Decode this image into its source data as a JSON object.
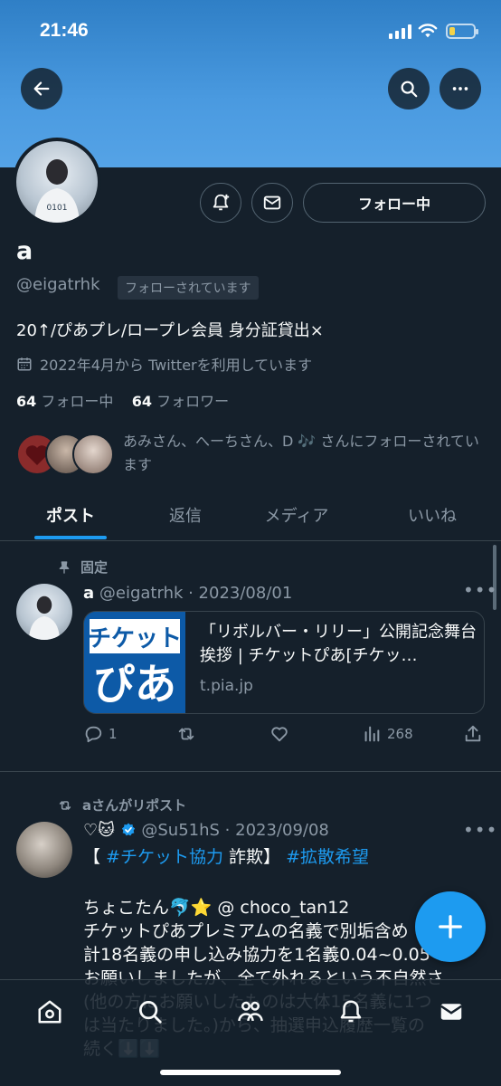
{
  "status_bar": {
    "time": "21:46"
  },
  "profile": {
    "name": "a",
    "handle": "@eigatrhk",
    "follows_you_badge": "フォローされています",
    "follow_button_label": "フォロー中",
    "bio": "20↑/ぴあプレ/ロープレ会員 身分証貸出×",
    "joined": "2022年4月から Twitterを利用しています",
    "following_count": "64",
    "following_label": "フォロー中",
    "followers_count": "64",
    "followers_label": "フォロワー",
    "followers_you_know": "あみさん、へーちさん、D 🎶 さんにフォローされています"
  },
  "tabs": [
    {
      "label": "ポスト"
    },
    {
      "label": "返信"
    },
    {
      "label": "メディア"
    },
    {
      "label": "いいね"
    }
  ],
  "posts": [
    {
      "context": "固定",
      "name": "a",
      "handle_date": "@eigatrhk · 2023/08/01",
      "card": {
        "image_text_top": "チケット",
        "image_text_bottom": "ぴあ",
        "title": "「リボルバー・リリー」公開記念舞台挨拶 | チケットぴあ[チケッ…",
        "domain": "t.pia.jp"
      },
      "replies": "1",
      "retweets": "",
      "likes": "",
      "views": "268"
    },
    {
      "context": "aさんがリポスト",
      "name": "♡🐱",
      "handle_date": "@Su51hS · 2023/09/08",
      "line1_a": "【 ",
      "line1_link1": "#チケット協力",
      "line1_b": " 詐欺】 ",
      "line1_link2": "#拡散希望",
      "body": "ちょこたん🐬⭐️ @ choco_tan12\nチケットぴあプレミアムの名義で別垢含め\n計18名義の申し込み協力を1名義0.04~0.05で\nお願いしましたが、全て外れるという不自然さ\n(他の方にお願いしたものは大体15名義に1つ\nは当たりました。)から、抽選申込履歴一覧の\n続く⬇️⬇️"
    }
  ],
  "colors": {
    "background": "#15202b",
    "accent": "#1d9bf0",
    "secondary_text": "#8b98a5",
    "banner": "#4a9ae0"
  }
}
